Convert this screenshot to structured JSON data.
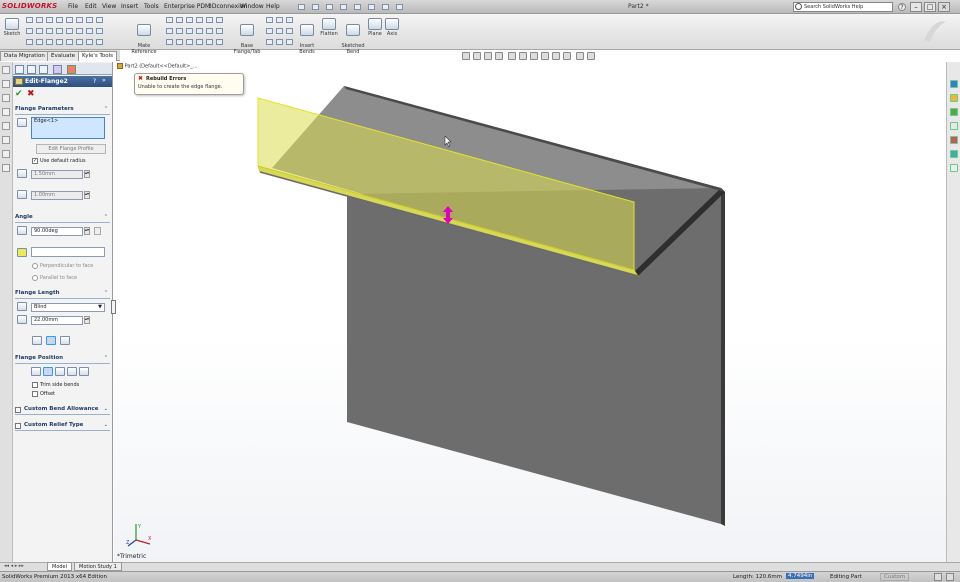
{
  "app": {
    "logo": "SOLIDWORKS",
    "title": "Part2 *"
  },
  "menu": [
    "File",
    "Edit",
    "View",
    "Insert",
    "Tools",
    "Enterprise PDM",
    "3Dconnexion",
    "Window",
    "Help"
  ],
  "search": {
    "placeholder": "Search SolidWorks Help"
  },
  "commands": {
    "sketch": "Sketch",
    "mate_reference": "Mate\nReference",
    "base_flange": "Base\nFlange/Tab",
    "insert_bends": "Insert\nBends",
    "flatten": "Flatten",
    "sketched_bend": "Sketched\nBend",
    "plane": "Plane",
    "axis": "Axis"
  },
  "cmd_tabs": [
    "Data Migration",
    "Evaluate",
    "Kyle's Tools"
  ],
  "property_manager": {
    "title": "Edit-Flange2",
    "sections": {
      "flange_parameters": "Flange Parameters",
      "edge_value": "Edge<1>",
      "edit_profile": "Edit Flange Profile",
      "use_default_radius": "Use default radius",
      "radius": "1.50mm",
      "gap": "1.00mm",
      "angle": "Angle",
      "angle_value": "90.00deg",
      "perpendicular": "Perpendicular to face",
      "parallel": "Parallel to face",
      "flange_length": "Flange Length",
      "end_condition": "Blind",
      "length_value": "22.00mm",
      "flange_position": "Flange Position",
      "trim_side_bends": "Trim side bends",
      "offset": "Offset",
      "custom_bend_allowance": "Custom Bend Allowance",
      "custom_relief_type": "Custom Relief Type"
    }
  },
  "tree": {
    "root": "Part2 (Default<<Default>_..."
  },
  "error_popup": {
    "title": "Rebuild Errors",
    "message": "Unable to create the edge flange."
  },
  "view_name": "*Trimetric",
  "bottom_tabs": [
    "Model",
    "Motion Study 1"
  ],
  "status": {
    "edition": "SolidWorks Premium 2013 x64 Edition",
    "length": "Length: 120.6mm",
    "length_highlight": "4.7494in",
    "mode": "Editing Part",
    "units": "Custom"
  }
}
